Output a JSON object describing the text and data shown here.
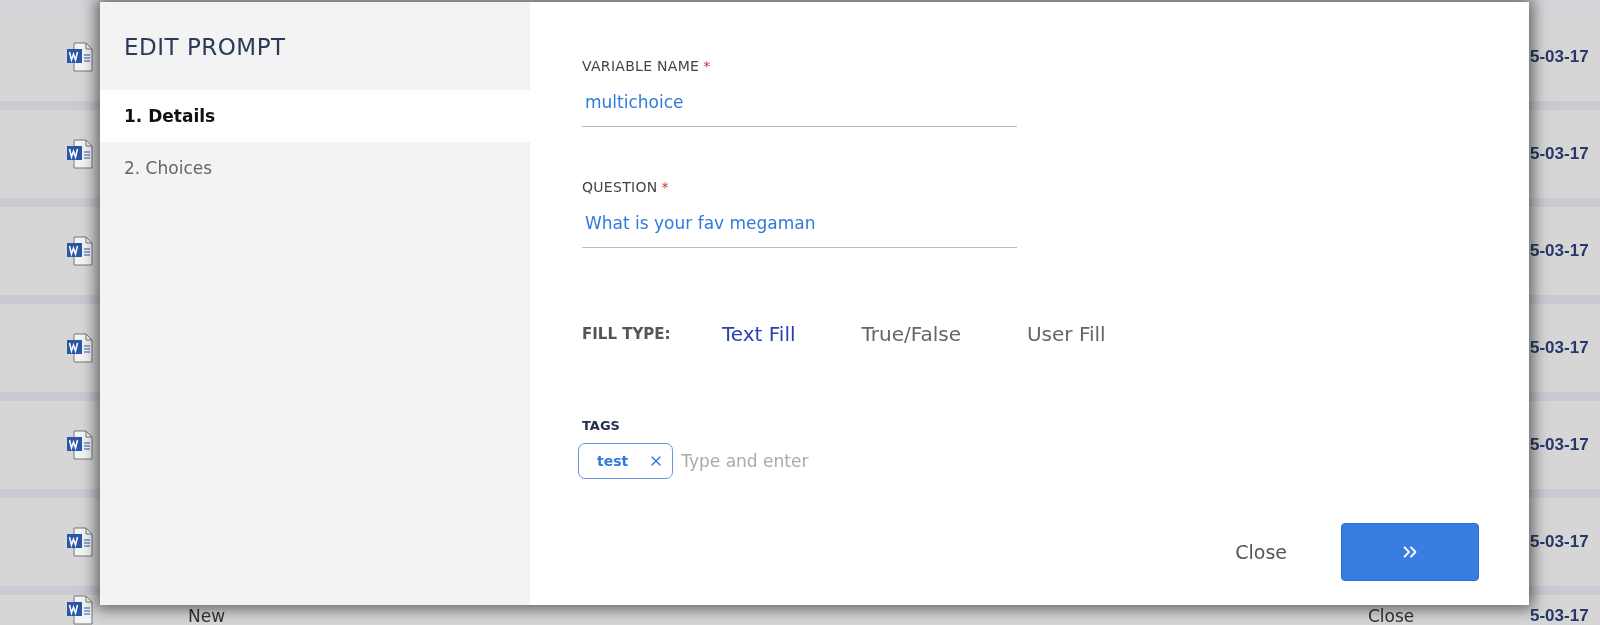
{
  "background_list": {
    "rows": [
      {
        "date": "5-03-17"
      },
      {
        "date": "5-03-17"
      },
      {
        "date": "5-03-17"
      },
      {
        "date": "5-03-17"
      },
      {
        "date": "5-03-17"
      },
      {
        "date": "5-03-17"
      },
      {
        "title": "New",
        "date": "5-03-17",
        "action": "Close"
      }
    ]
  },
  "dialog": {
    "title": "EDIT PROMPT",
    "steps": [
      {
        "label": "1. Details",
        "selected": true
      },
      {
        "label": "2. Choices",
        "selected": false
      }
    ],
    "fields": [
      {
        "label": "VARIABLE NAME",
        "required_mark": "*",
        "value": "multichoice"
      },
      {
        "label": "QUESTION",
        "required_mark": "*",
        "value": "What is your fav megaman"
      }
    ],
    "fill_type": {
      "label": "FILL TYPE:",
      "options": [
        {
          "label": "Text Fill",
          "selected": true
        },
        {
          "label": "True/False",
          "selected": false
        },
        {
          "label": "User Fill",
          "selected": false
        }
      ]
    },
    "tags": {
      "label": "TAGS",
      "items": [
        {
          "label": "test"
        }
      ],
      "placeholder": "Type and enter"
    },
    "close_button": "Close"
  }
}
